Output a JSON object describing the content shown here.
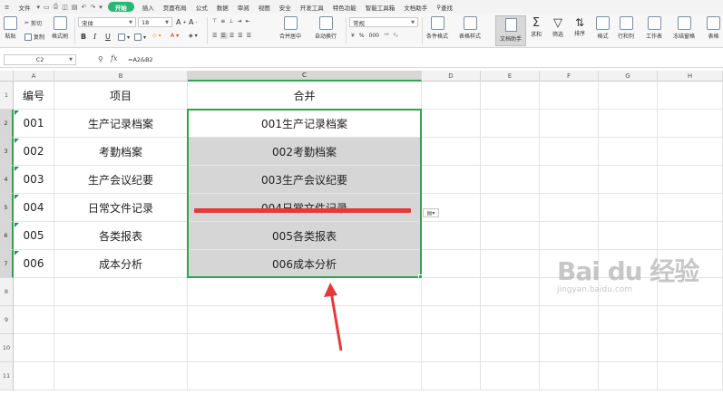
{
  "menu": {
    "file": "文件",
    "tabs": [
      "开始",
      "插入",
      "页面布局",
      "公式",
      "数据",
      "审阅",
      "视图",
      "安全",
      "开发工具",
      "特色功能",
      "智能工具箱",
      "文档助手"
    ],
    "active_tab": "开始",
    "search": "查找"
  },
  "ribbon": {
    "paste": "粘贴",
    "cut": "剪切",
    "copy": "复制",
    "format_painter": "格式刷",
    "font_name": "宋体",
    "font_size": "18",
    "bold": "B",
    "italic": "I",
    "underline": "U",
    "merge_center": "合并居中",
    "auto_wrap": "自动换行",
    "number_format": "常规",
    "currency": "¥",
    "percent": "%",
    "thousands": "000",
    "conditional_format": "条件格式",
    "table_style": "表格样式",
    "doc_helper": "文档助手",
    "sum": "求和",
    "filter": "筛选",
    "sort": "排序",
    "format": "格式",
    "row_col": "行和列",
    "worksheet": "工作表",
    "freeze": "冻结窗格",
    "table_tools": "表格"
  },
  "formula_bar": {
    "cell_ref": "C2",
    "fx": "fx",
    "formula": "=A2&B2"
  },
  "sheet": {
    "columns": [
      "A",
      "B",
      "C",
      "D",
      "E",
      "F",
      "G",
      "H"
    ],
    "rows": [
      "1",
      "2",
      "3",
      "4",
      "5",
      "6",
      "7",
      "8",
      "9",
      "10",
      "11"
    ],
    "headers": [
      "编号",
      "项目",
      "合并"
    ],
    "data": [
      [
        "001",
        "生产记录档案",
        "001生产记录档案"
      ],
      [
        "002",
        "考勤档案",
        "002考勤档案"
      ],
      [
        "003",
        "生产会议纪要",
        "003生产会议纪要"
      ],
      [
        "004",
        "日常文件记录",
        "004日常文件记录"
      ],
      [
        "005",
        "各类报表",
        "005各类报表"
      ],
      [
        "006",
        "成本分析",
        "006成本分析"
      ]
    ],
    "selected_column": "C",
    "selected_rows": [
      "2",
      "3",
      "4",
      "5",
      "6",
      "7"
    ]
  },
  "watermark": {
    "main": "Bai du 经验",
    "sub": "jingyan.baidu.com"
  },
  "colors": {
    "active_tab": "#2bb673",
    "selection_border": "#33a24f",
    "arrow": "#e53a3a",
    "selection_fill": "#d6d6d6"
  }
}
